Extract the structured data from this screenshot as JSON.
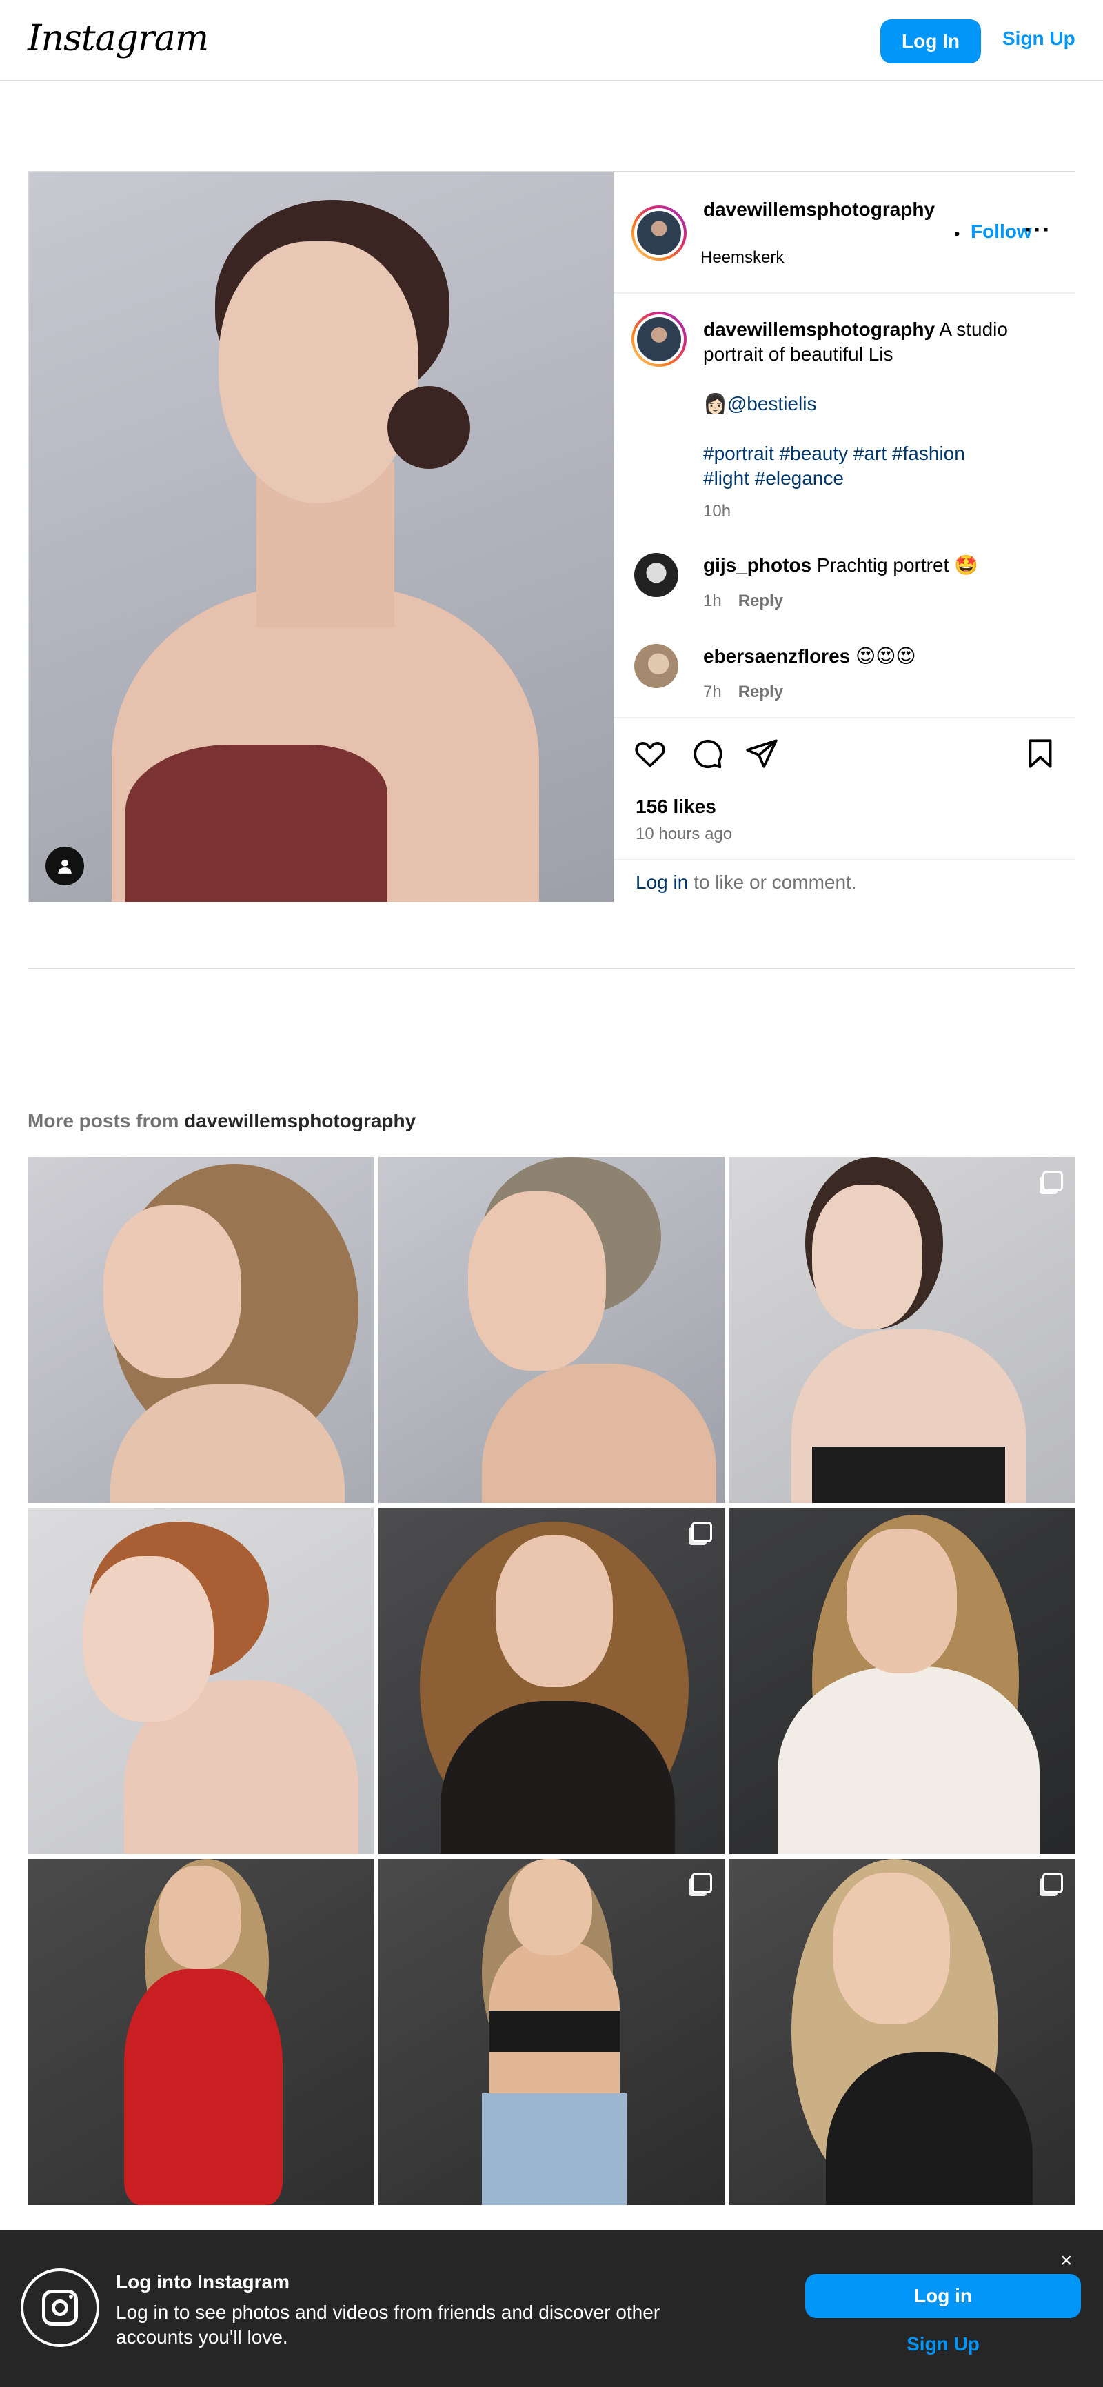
{
  "header": {
    "logo": "Instagram",
    "login_label": "Log In",
    "signup_label": "Sign Up"
  },
  "post": {
    "username": "davewillemsphotography",
    "follow_dot": "•",
    "follow_label": "Follow",
    "more_label": "···",
    "location": "Heemskerk",
    "caption_user": "davewillemsphotography",
    "caption_text": " A studio portrait of beautiful Lis",
    "mention": "👩🏻@bestielis",
    "hashtags_line1": "#portrait #beauty #art #fashion",
    "hashtags_line2": "#light #elegance",
    "caption_time": "10h",
    "comments": [
      {
        "user": "gijs_photos",
        "text": " Prachtig portret 🤩",
        "time": "1h",
        "reply": "Reply"
      },
      {
        "user": "ebersaenzflores",
        "text": " 😍😍😍",
        "time": "7h",
        "reply": "Reply"
      }
    ],
    "likes": "156 likes",
    "posted_ago": "10 hours ago",
    "login_link": "Log in",
    "login_suffix": " to like or comment."
  },
  "more_posts": {
    "prefix": "More posts from ",
    "username": "davewillemsphotography"
  },
  "banner": {
    "title": "Log into Instagram",
    "text": "Log in to see photos and videos from friends and discover other accounts you'll love.",
    "close": "×",
    "login_label": "Log in",
    "signup_label": "Sign Up"
  },
  "icons": [
    "heart-icon",
    "comment-icon",
    "share-icon",
    "bookmark-icon",
    "user-tag-icon",
    "multi-photo-icon",
    "instagram-icon",
    "close-icon",
    "more-icon"
  ]
}
